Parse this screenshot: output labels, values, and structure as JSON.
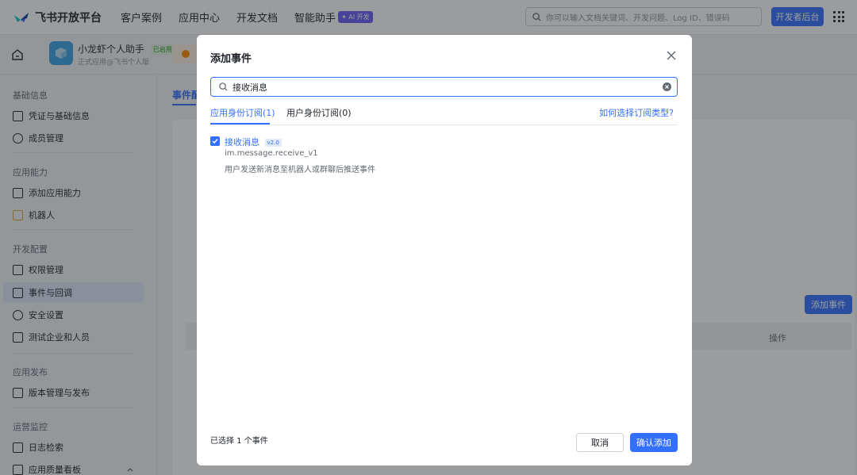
{
  "topbar": {
    "logo_text": "飞书开放平台",
    "nav": [
      "客户案例",
      "应用中心",
      "开发文档",
      "智能助手"
    ],
    "ai_badge": "✦ AI 开发",
    "search_placeholder": "你可以输入文档关键词、开发问题、Log ID、错误码",
    "dev_console_label": "开发者后台"
  },
  "app": {
    "name": "小龙虾个人助手",
    "status": "已启用",
    "subtitle": "正式应用@飞书个人版"
  },
  "sidebar": {
    "sections": [
      {
        "title": "基础信息",
        "items": [
          "凭证与基础信息",
          "成员管理"
        ]
      },
      {
        "title": "应用能力",
        "items": [
          "添加应用能力",
          "机器人"
        ]
      },
      {
        "title": "开发配置",
        "items": [
          "权限管理",
          "事件与回调",
          "安全设置",
          "测试企业和人员"
        ]
      },
      {
        "title": "应用发布",
        "items": [
          "版本管理与发布"
        ]
      },
      {
        "title": "运营监控",
        "items": [
          "日志检索",
          "应用质量看板"
        ]
      }
    ],
    "active_item": "事件与回调"
  },
  "main": {
    "tab_label": "事件配",
    "add_event_label": "添加事件",
    "operation_label": "操作"
  },
  "modal": {
    "title": "添加事件",
    "search_value": "接收消息",
    "tabs": [
      "应用身份订阅(1)",
      "用户身份订阅(0)"
    ],
    "help_link": "如何选择订阅类型?",
    "event": {
      "name": "接收消息",
      "version": "v2.0",
      "key": "im.message.receive_v1",
      "description": "用户发送新消息至机器人或群聊后推送事件",
      "checked": true
    },
    "selected_count": "已选择 1 个事件",
    "cancel_label": "取消",
    "confirm_label": "确认添加"
  },
  "colors": {
    "accent": "#3370ff",
    "ai_badge": "#6b5cf6",
    "active_bg": "#e1e9fc"
  }
}
